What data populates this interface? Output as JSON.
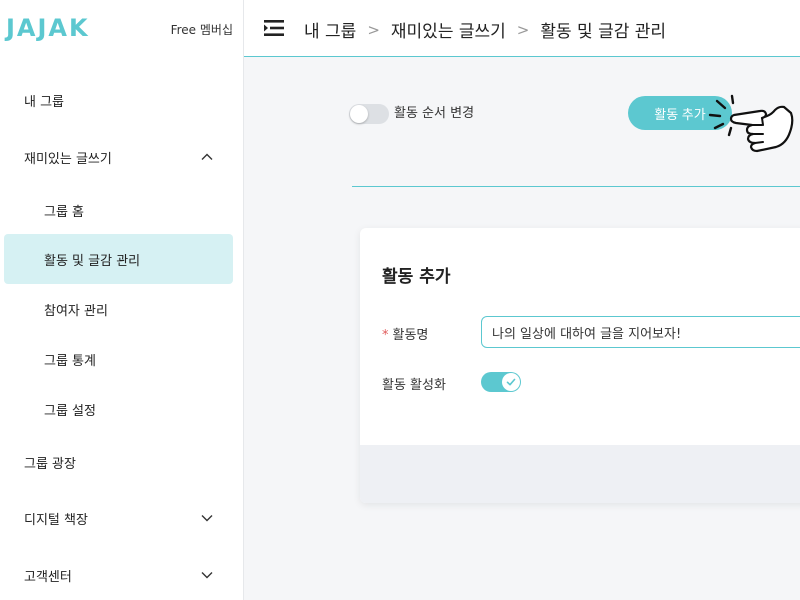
{
  "brand": {
    "logo": "JAJAK",
    "plan": "Free 멤버십"
  },
  "sidebar": {
    "items": [
      {
        "label": "내 그룹"
      },
      {
        "label": "재미있는 글쓰기",
        "chevron": "chevron-up-icon"
      },
      {
        "label": "그룹 홈"
      },
      {
        "label": "활동 및 글감 관리",
        "active": true
      },
      {
        "label": "참여자 관리"
      },
      {
        "label": "그룹 통계"
      },
      {
        "label": "그룹 설정"
      },
      {
        "label": "그룹 광장"
      },
      {
        "label": "디지털 책장",
        "chevron": "chevron-down-icon"
      },
      {
        "label": "고객센터",
        "chevron": "chevron-down-icon"
      }
    ]
  },
  "header": {
    "menu_icon": "menu-collapse-icon",
    "breadcrumb": [
      "내 그룹",
      "재미있는 글쓰기",
      "활동 및 글감 관리"
    ],
    "separator": ">"
  },
  "toolbar": {
    "reorder_toggle_label": "활동 순서 변경",
    "reorder_toggle_on": false,
    "add_button_label": "활동 추가"
  },
  "form": {
    "title": "활동 추가",
    "required_mark": "*",
    "name_label": "활동명",
    "name_value": "나의 일상에 대하여 글을 지어보자!",
    "active_label": "활동 활성화",
    "active_on": true
  },
  "colors": {
    "accent": "#5cc8d0",
    "active_bg": "#d6f1f3",
    "required": "#e05a5a"
  }
}
